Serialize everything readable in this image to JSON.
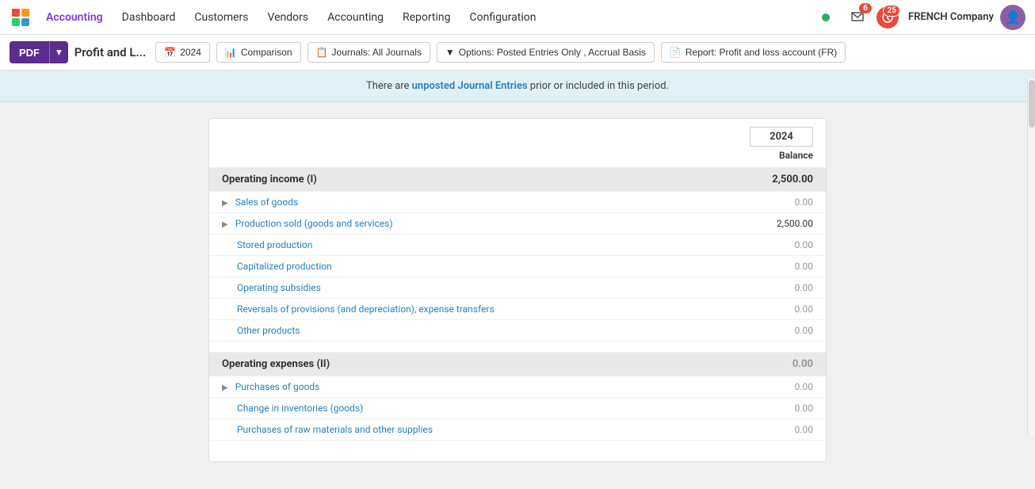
{
  "nav": {
    "logo_alt": "Odoo Logo",
    "items": [
      {
        "label": "Accounting",
        "active": true
      },
      {
        "label": "Dashboard",
        "active": false
      },
      {
        "label": "Customers",
        "active": false
      },
      {
        "label": "Vendors",
        "active": false
      },
      {
        "label": "Accounting",
        "active": false
      },
      {
        "label": "Reporting",
        "active": false
      },
      {
        "label": "Configuration",
        "active": false
      }
    ],
    "company": "FRENCH Company",
    "message_badge": "6",
    "activity_badge": "25"
  },
  "toolbar": {
    "pdf_label": "PDF",
    "page_title": "Profit and L...",
    "filters": [
      {
        "icon": "📅",
        "label": "2024"
      },
      {
        "icon": "📊",
        "label": "Comparison"
      },
      {
        "icon": "📋",
        "label": "Journals: All Journals"
      },
      {
        "icon": "▼",
        "label": "Options: Posted Entries Only , Accrual Basis"
      },
      {
        "icon": "📄",
        "label": "Report: Profit and loss account (FR)"
      }
    ]
  },
  "notice": {
    "prefix": "There are ",
    "highlight": "unposted Journal Entries",
    "suffix": " prior or included in this period."
  },
  "report": {
    "year": "2024",
    "balance_label": "Balance",
    "sections": [
      {
        "id": "operating_income",
        "label": "Operating income (I)",
        "value": "2,500.00",
        "rows": [
          {
            "expand": true,
            "label": "Sales of goods",
            "value": "0.00",
            "dim": true,
            "blue": true
          },
          {
            "expand": true,
            "label": "Production sold (goods and services)",
            "value": "2,500.00",
            "dim": false,
            "blue": true
          },
          {
            "expand": false,
            "label": "Stored production",
            "value": "0.00",
            "dim": true,
            "blue": true
          },
          {
            "expand": false,
            "label": "Capitalized production",
            "value": "0.00",
            "dim": true,
            "blue": true
          },
          {
            "expand": false,
            "label": "Operating subsidies",
            "value": "0.00",
            "dim": true,
            "blue": true
          },
          {
            "expand": false,
            "label": "Reversals of provisions (and depreciation), expense transfers",
            "value": "0.00",
            "dim": true,
            "blue": true
          },
          {
            "expand": false,
            "label": "Other products",
            "value": "0.00",
            "dim": true,
            "blue": true
          }
        ]
      },
      {
        "id": "operating_expenses",
        "label": "Operating expenses (II)",
        "value": "0.00",
        "value_dim": true,
        "rows": [
          {
            "expand": true,
            "label": "Purchases of goods",
            "value": "0.00",
            "dim": true,
            "blue": true
          },
          {
            "expand": false,
            "label": "Change in inventories (goods)",
            "value": "0.00",
            "dim": true,
            "blue": true
          },
          {
            "expand": false,
            "label": "Purchases of raw materials and other supplies",
            "value": "0.00",
            "dim": true,
            "blue": true
          }
        ]
      }
    ]
  }
}
